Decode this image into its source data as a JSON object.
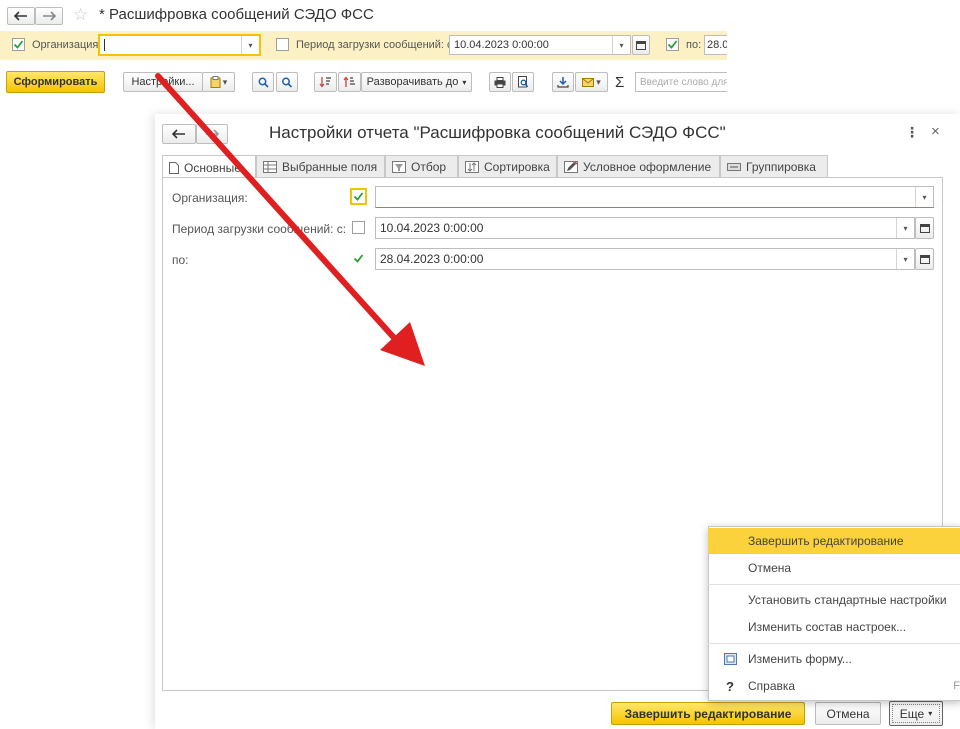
{
  "window": {
    "title": "* Расшифровка сообщений СЭДО ФСС"
  },
  "toolbar": {
    "org_label": "Организация:",
    "org_value": "",
    "period_label": "Период загрузки сообщений: с:",
    "period_from": "10.04.2023  0:00:00",
    "to_label": "по:",
    "period_to_partial": "28.0",
    "generate_btn": "Сформировать",
    "settings_btn": "Настройки...",
    "expand_btn": "Разворачивать до",
    "sigma": "Σ",
    "search_placeholder": "Введите слово для"
  },
  "dialog": {
    "title": "Настройки отчета \"Расшифровка сообщений СЭДО ФСС\"",
    "tabs": [
      {
        "label": "Основные",
        "icon": "document-icon"
      },
      {
        "label": "Выбранные поля",
        "icon": "fields-icon"
      },
      {
        "label": "Отбор",
        "icon": "filter-icon"
      },
      {
        "label": "Сортировка",
        "icon": "sort-icon"
      },
      {
        "label": "Условное оформление",
        "icon": "pen-icon"
      },
      {
        "label": "Группировка",
        "icon": "group-icon"
      }
    ],
    "fields": {
      "org_label": "Организация:",
      "org_value": "",
      "period_label": "Период загрузки сообщений: с:",
      "period_from": "10.04.2023  0:00:00",
      "to_label": "по:",
      "period_to": "28.04.2023  0:00:00"
    },
    "footer": {
      "finish_btn": "Завершить редактирование",
      "cancel_btn": "Отмена",
      "more_btn": "Еще"
    }
  },
  "context_menu": {
    "items": [
      {
        "label": "Завершить редактирование",
        "highlighted": true
      },
      {
        "label": "Отмена"
      },
      {
        "label": "Установить стандартные настройки"
      },
      {
        "label": "Изменить состав настроек..."
      },
      {
        "label": "Изменить форму...",
        "icon": "form-icon"
      },
      {
        "label": "Справка",
        "icon": "help-icon",
        "glyph": "?",
        "shortcut": "F"
      }
    ]
  },
  "colors": {
    "accent_yellow": "#f5c400",
    "highlight": "#fbd13c",
    "arrow_red": "#e02020",
    "check_green": "#2e9e3a"
  }
}
